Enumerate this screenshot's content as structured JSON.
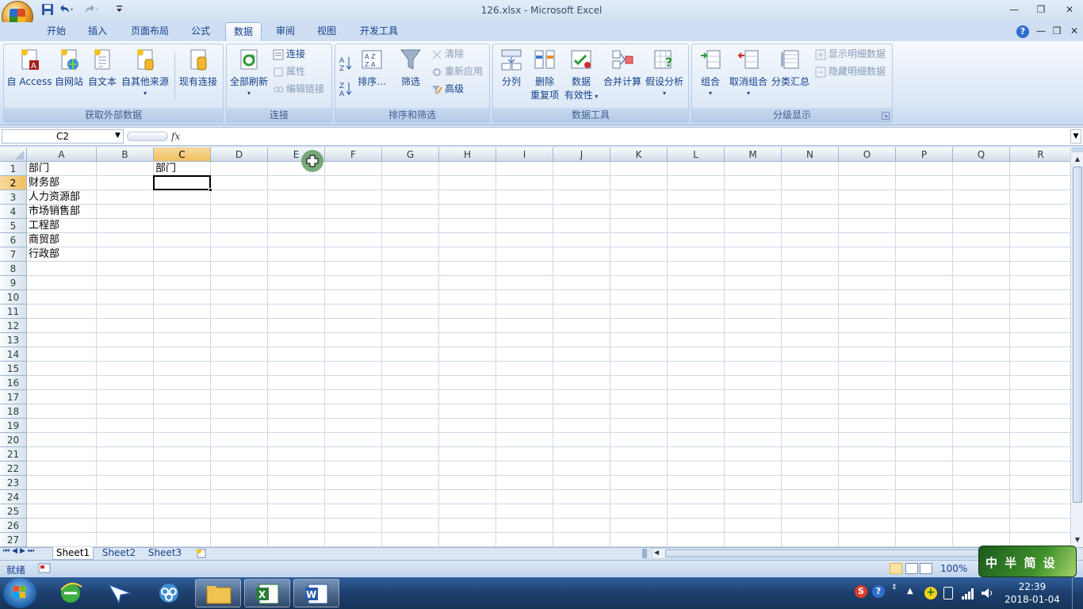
{
  "window": {
    "title": "126.xlsx - Microsoft Excel"
  },
  "tabs": [
    "开始",
    "插入",
    "页面布局",
    "公式",
    "数据",
    "审阅",
    "视图",
    "开发工具"
  ],
  "ribbon": {
    "get_external": {
      "title": "获取外部数据",
      "access": "自 Access",
      "web": "自网站",
      "text": "自文本",
      "other": "自其他来源",
      "existing": "现有连接"
    },
    "connections": {
      "title": "连接",
      "refresh_all": "全部刷新",
      "connections": "连接",
      "properties": "属性",
      "edit_links": "编辑链接"
    },
    "sort_filter": {
      "title": "排序和筛选",
      "sort": "排序...",
      "filter": "筛选",
      "clear": "清除",
      "reapply": "重新应用",
      "advanced": "高级"
    },
    "data_tools": {
      "title": "数据工具",
      "text_to_columns": "分列",
      "remove_dup_1": "删除",
      "remove_dup_2": "重复项",
      "validation_1": "数据",
      "validation_2": "有效性",
      "consolidate": "合并计算",
      "whatif": "假设分析"
    },
    "outline": {
      "title": "分级显示",
      "group": "组合",
      "ungroup": "取消组合",
      "subtotal": "分类汇总",
      "show_detail": "显示明细数据",
      "hide_detail": "隐藏明细数据"
    }
  },
  "formula_bar": {
    "name_box": "C2",
    "fx": "fx",
    "value": ""
  },
  "columns": [
    "A",
    "B",
    "C",
    "D",
    "E",
    "F",
    "G",
    "H",
    "I",
    "J",
    "K",
    "L",
    "M",
    "N",
    "O",
    "P",
    "Q",
    "R"
  ],
  "rows": [
    "1",
    "2",
    "3",
    "4",
    "5",
    "6",
    "7",
    "8",
    "9",
    "10",
    "11",
    "12",
    "13",
    "14",
    "15",
    "16",
    "17",
    "18",
    "19",
    "20",
    "21",
    "22",
    "23",
    "24",
    "25",
    "26",
    "27"
  ],
  "cells": {
    "A1": "部门",
    "A2": "财务部",
    "A3": "人力资源部",
    "A4": "市场销售部",
    "A5": "工程部",
    "A6": "商贸部",
    "A7": "行政部",
    "C1": "部门"
  },
  "sheets": [
    "Sheet1",
    "Sheet2",
    "Sheet3"
  ],
  "status": {
    "ready": "就绪",
    "zoom": "100%"
  },
  "watermark": "中 半 简 设",
  "clock": {
    "time": "22:39",
    "date": "2018-01-04"
  }
}
